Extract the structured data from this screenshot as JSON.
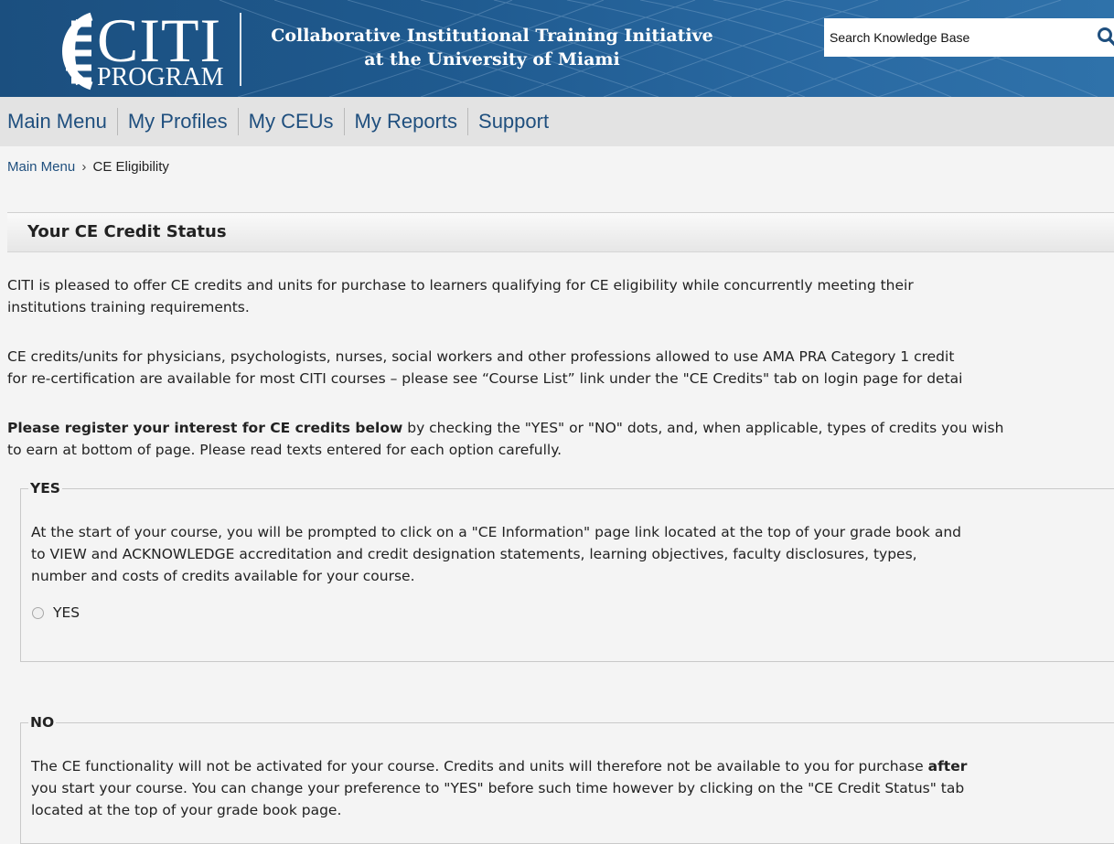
{
  "header": {
    "logo_main": "CITI",
    "logo_sub": "PROGRAM",
    "tagline_line1": "Collaborative Institutional Training Initiative",
    "tagline_line2": "at the University of Miami",
    "search_placeholder": "Search Knowledge Base",
    "search_icon": "search-icon",
    "colors": {
      "header_bg": "#1f5a8f",
      "nav_bg": "#e3e3e3",
      "link": "#1f4f7e"
    }
  },
  "nav": {
    "items": [
      {
        "label": "Main Menu"
      },
      {
        "label": "My Profiles"
      },
      {
        "label": "My CEUs"
      },
      {
        "label": "My Reports"
      },
      {
        "label": "Support"
      }
    ]
  },
  "breadcrumb": {
    "parent": "Main Menu",
    "separator": "›",
    "current": "CE Eligibility"
  },
  "panel": {
    "title": "Your CE Credit Status",
    "p1_line1": "CITI is pleased to offer CE credits and units for purchase to learners qualifying for CE eligibility while concurrently meeting their",
    "p1_line2": "institutions training requirements.",
    "p2_line1": "CE credits/units for physicians, psychologists, nurses, social workers and other professions allowed to use AMA PRA Category 1 credit",
    "p2_line2": "for re-certification are available for most CITI courses – please see “Course List” link under the \"CE Credits\" tab on login page for detai",
    "p3_bold": "Please register your interest for CE credits below",
    "p3_line1_rest": " by checking the \"YES\" or \"NO\" dots, and, when applicable, types of credits you wish",
    "p3_line2": "to earn at bottom of page. Please read texts entered for each option carefully."
  },
  "yes_option": {
    "legend": "YES",
    "line1": "At the start of your course, you will be prompted to click on a \"CE Information\" page link located at the top of your grade book and",
    "line2": "to VIEW and ACKNOWLEDGE accreditation and credit designation statements, learning objectives, faculty disclosures, types,",
    "line3": "number and costs of credits available for your course.",
    "radio_label": "YES",
    "selected": false
  },
  "no_option": {
    "legend": "NO",
    "line1_start": "The CE functionality will not be activated for your course. Credits and units will therefore not be available to you for purchase ",
    "line1_bold": "after",
    "line2": "you start your course. You can change your preference to \"YES\" before such time however by clicking on the \"CE Credit Status\" tab",
    "line3": "located at the top of your grade book page."
  }
}
